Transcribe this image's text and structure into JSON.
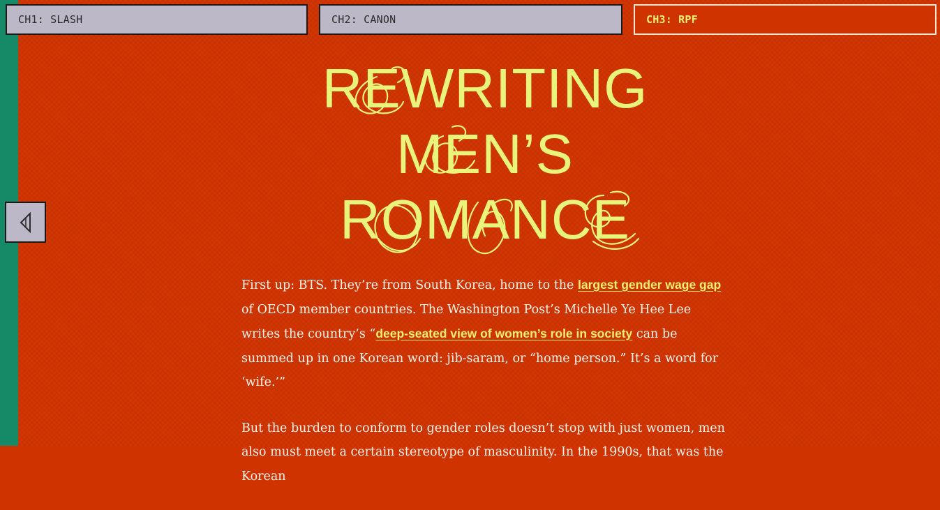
{
  "tabs": [
    {
      "label": "CH1: SLASH",
      "active": false
    },
    {
      "label": "CH2: CANON",
      "active": false
    },
    {
      "label": "CH3: RPF",
      "active": true
    }
  ],
  "nav": {
    "prev_icon": "triangle-left-icon"
  },
  "title": {
    "line1": "REWRITING",
    "line2": "MEN’S",
    "line3": "ROMANCE"
  },
  "article": {
    "p1_a": "First up: BTS. They’re from South Korea, home to the ",
    "p1_link1": "largest gender wage gap",
    "p1_b": " of OECD member countries. The Washington Post’s Michelle Ye Hee Lee writes the country’s “",
    "p1_link2": "deep-seated view of women’s role in society",
    "p1_c": " can be summed up in one Korean word: jib-saram, or “home person.” It’s a word for ‘wife.’”",
    "p2": "But the burden to conform to gender roles doesn’t stop with just women, men also must meet a certain stereotype of masculinity. In the 1990s, that was the Korean"
  },
  "colors": {
    "background": "#cf3300",
    "accent_yellow": "#e8f57a",
    "tab_gray": "#bdb8c8",
    "left_strip_green": "#168a67"
  }
}
